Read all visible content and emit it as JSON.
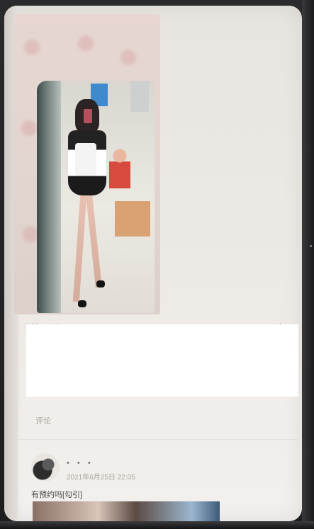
{
  "post": {
    "view_count": "浏览567次",
    "share_icon": "share-icon"
  },
  "comments_section": {
    "comment_link": "评论"
  },
  "comment": {
    "username": "• • •",
    "timestamp": "2021年6月25日 22:05",
    "text": "有预约吗[勾引]"
  }
}
